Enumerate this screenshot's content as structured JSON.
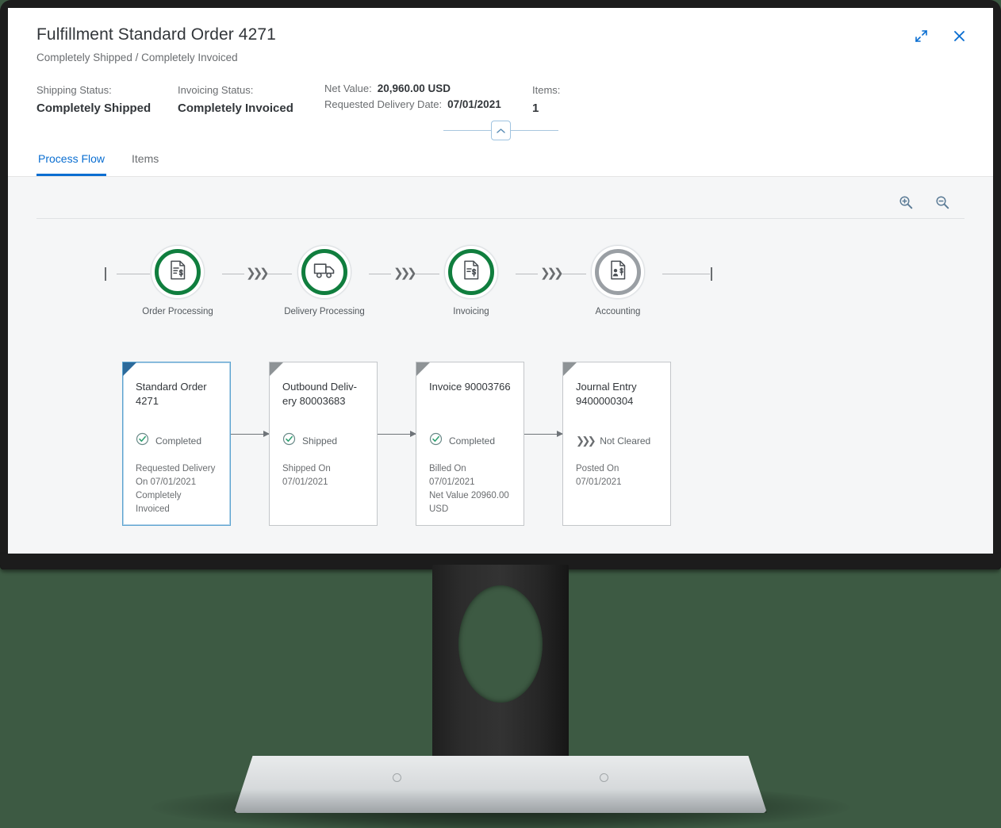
{
  "header": {
    "title": "Fulfillment Standard Order 4271",
    "subtitle": "Completely Shipped / Completely Invoiced",
    "shipping_status_label": "Shipping Status:",
    "shipping_status_value": "Completely Shipped",
    "invoicing_status_label": "Invoicing Status:",
    "invoicing_status_value": "Completely Invoiced",
    "net_value_label": "Net Value:",
    "net_value": "20,960.00 USD",
    "requested_delivery_label": "Requested Delivery Date:",
    "requested_delivery_date": "07/01/2021",
    "items_label": "Items:",
    "items_count": "1",
    "fullscreen_icon": "fullscreen-icon",
    "close_icon": "close-icon",
    "collapse_icon": "chevron-up-icon"
  },
  "tabs": [
    {
      "label": "Process Flow",
      "active": true
    },
    {
      "label": "Items",
      "active": false
    }
  ],
  "toolbar": {
    "zoom_in_icon": "zoom-in-icon",
    "zoom_out_icon": "zoom-out-icon"
  },
  "flow_nodes": [
    {
      "label": "Order Processing",
      "icon": "order-document-icon",
      "state": "green"
    },
    {
      "label": "Delivery Processing",
      "icon": "delivery-truck-icon",
      "state": "green"
    },
    {
      "label": "Invoicing",
      "icon": "invoice-document-icon",
      "state": "green"
    },
    {
      "label": "Accounting",
      "icon": "journal-entry-icon",
      "state": "gray"
    }
  ],
  "cards": [
    {
      "title": "Standard Order 4271",
      "status": "Completed",
      "status_icon": "check-circle-icon",
      "detail_lines": [
        "Requested Delivery",
        "On 07/01/2021",
        "Completely",
        "Invoiced"
      ],
      "selected": true
    },
    {
      "title": "Outbound Deliv-ery 80003683",
      "status": "Shipped",
      "status_icon": "check-circle-icon",
      "detail_lines": [
        "Shipped On",
        "07/01/2021"
      ],
      "selected": false
    },
    {
      "title": "Invoice 90003766",
      "status": "Completed",
      "status_icon": "check-circle-icon",
      "detail_lines": [
        "Billed On",
        "07/01/2021",
        "Net Value 20960.00",
        "USD"
      ],
      "selected": false
    },
    {
      "title": "Journal Entry 9400000304",
      "status": "Not Cleared",
      "status_icon": "chevrons-icon",
      "detail_lines": [
        "Posted On",
        "07/01/2021"
      ],
      "selected": false
    }
  ],
  "colors": {
    "accent": "#0a6ed1",
    "success": "#107e3e",
    "neutral": "#9a9fa4",
    "text": "#32363a",
    "muted": "#6a6d70",
    "backdrop": "#3d5a43"
  }
}
